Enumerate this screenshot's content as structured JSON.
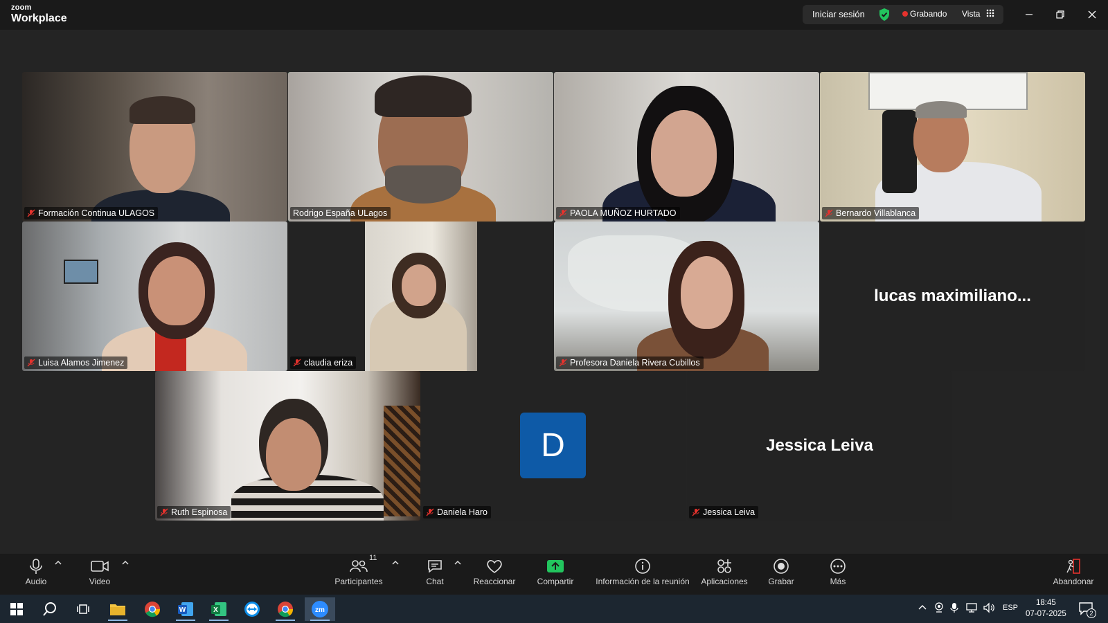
{
  "titlebar": {
    "logo_small": "zoom",
    "logo_big": "Workplace",
    "signin": "Iniciar sesión",
    "recording": "Grabando",
    "view": "Vista"
  },
  "participants": {
    "p1": "Formación Continua ULAGOS",
    "p2": "Rodrigo España ULagos",
    "p3": "PAOLA MUÑOZ HURTADO",
    "p4": "Bernardo Villablanca",
    "p5": "Luisa Alamos Jimenez",
    "p6": "claudia eriza",
    "p7": "Profesora Daniela Rivera Cubillos",
    "p8_display": "lucas  maximiliano...",
    "p9": "Ruth Espinosa",
    "p10": "Daniela Haro",
    "p10_avatar": "D",
    "p11": "Jessica Leiva",
    "p11_display": "Jessica Leiva"
  },
  "toolbar": {
    "audio": "Audio",
    "video": "Video",
    "participants": "Participantes",
    "participants_count": "11",
    "chat": "Chat",
    "react": "Reaccionar",
    "share": "Compartir",
    "info": "Información de la reunión",
    "apps": "Aplicaciones",
    "record": "Grabar",
    "more": "Más",
    "leave": "Abandonar"
  },
  "taskbar": {
    "lang": "ESP",
    "time": "18:45",
    "date": "07-07-2025",
    "notifications": "2"
  },
  "colors": {
    "active_speaker": "#24d38a",
    "share_green": "#22c55e",
    "recording_red": "#e5322d",
    "avatar_blue": "#0e5aa7"
  }
}
